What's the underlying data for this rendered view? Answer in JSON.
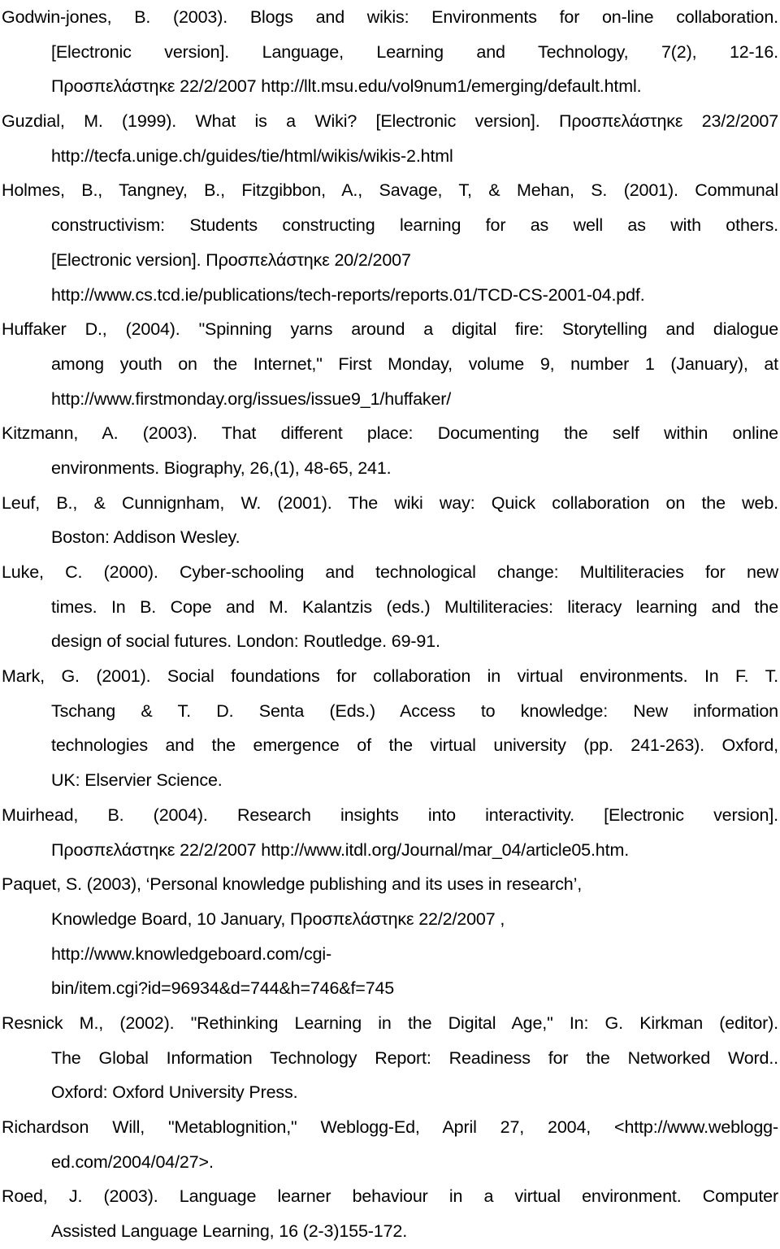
{
  "document": {
    "type": "reference-list",
    "entries": [
      {
        "author": "Godwin-jones",
        "lines": [
          "Godwin-jones, B. (2003). Blogs and wikis: Environments for on-line collaboration.",
          "[Electronic version]. Language, Learning and Technology, 7(2), 12-16.",
          "Προσπελάστηκε 22/2/2007 http://llt.msu.edu/vol9num1/emerging/default.html."
        ]
      },
      {
        "author": "Guzdial",
        "lines": [
          "Guzdial, M. (1999). What is a Wiki? [Electronic version]. Προσπελάστηκε 23/2/2007",
          "http://tecfa.unige.ch/guides/tie/html/wikis/wikis-2.html"
        ]
      },
      {
        "author": "Holmes",
        "lines": [
          "Holmes, B., Tangney, B., Fitzgibbon, A., Savage, T, & Mehan, S. (2001). Communal",
          "constructivism: Students constructing learning for as well as with others.",
          "[Electronic version]. Προσπελάστηκε 20/2/2007",
          "http://www.cs.tcd.ie/publications/tech-reports/reports.01/TCD-CS-2001-04.pdf."
        ]
      },
      {
        "author": "Huffaker",
        "lines": [
          "Huffaker D., (2004). \"Spinning yarns around a digital fire: Storytelling and dialogue",
          "among youth on the Internet,\" First Monday, volume 9, number 1 (January), at",
          "http://www.firstmonday.org/issues/issue9_1/huffaker/"
        ]
      },
      {
        "author": "Kitzmann",
        "lines": [
          "Kitzmann, A. (2003). That different place: Documenting the self within online",
          "environments. Biography, 26,(1), 48-65, 241."
        ]
      },
      {
        "author": "Leuf",
        "lines": [
          "Leuf, B., & Cunnignham, W. (2001). The wiki way: Quick collaboration on the web.",
          "Boston: Addison Wesley."
        ]
      },
      {
        "author": "Luke",
        "lines": [
          "Luke, C. (2000). Cyber-schooling and technological change: Multiliteracies for new",
          "times. In B. Cope and M. Kalantzis (eds.) Multiliteracies: literacy learning and the",
          "design of social futures. London: Routledge. 69-91."
        ]
      },
      {
        "author": "Mark",
        "lines": [
          "Mark, G. (2001). Social foundations for collaboration in virtual environments. In F. T.",
          "Tschang & T. D. Senta (Eds.) Access to knowledge: New information",
          "technologies and the emergence of the virtual university (pp. 241-263). Oxford,",
          "UK: Elservier Science."
        ]
      },
      {
        "author": "Muirhead",
        "lines": [
          "Muirhead, B. (2004). Research insights into interactivity. [Electronic version].",
          "Προσπελάστηκε 22/2/2007 http://www.itdl.org/Journal/mar_04/article05.htm."
        ]
      },
      {
        "author": "Paquet",
        "lines": [
          "Paquet, S. (2003), ‘Personal knowledge publishing and its uses in research’,",
          "Knowledge Board, 10 January, Προσπελάστηκε 22/2/2007 ,",
          "http://www.knowledgeboard.com/cgi-",
          "bin/item.cgi?id=96934&d=744&h=746&f=745"
        ]
      },
      {
        "author": "Resnick",
        "lines": [
          "Resnick M., (2002). \"Rethinking Learning in the Digital Age,\" In: G. Kirkman (editor).",
          "The Global Information Technology Report: Readiness for the Networked Word..",
          "Oxford: Oxford University Press."
        ]
      },
      {
        "author": "Richardson",
        "lines": [
          "Richardson Will, \"Metablognition,\" Weblogg-Ed, April 27, 2004, <http://www.weblogg-",
          "ed.com/2004/04/27>."
        ]
      },
      {
        "author": "Roed",
        "lines": [
          "Roed, J. (2003). Language learner behaviour in a virtual environment. Computer",
          "Assisted Language Learning, 16 (2-3)155-172."
        ]
      }
    ]
  }
}
